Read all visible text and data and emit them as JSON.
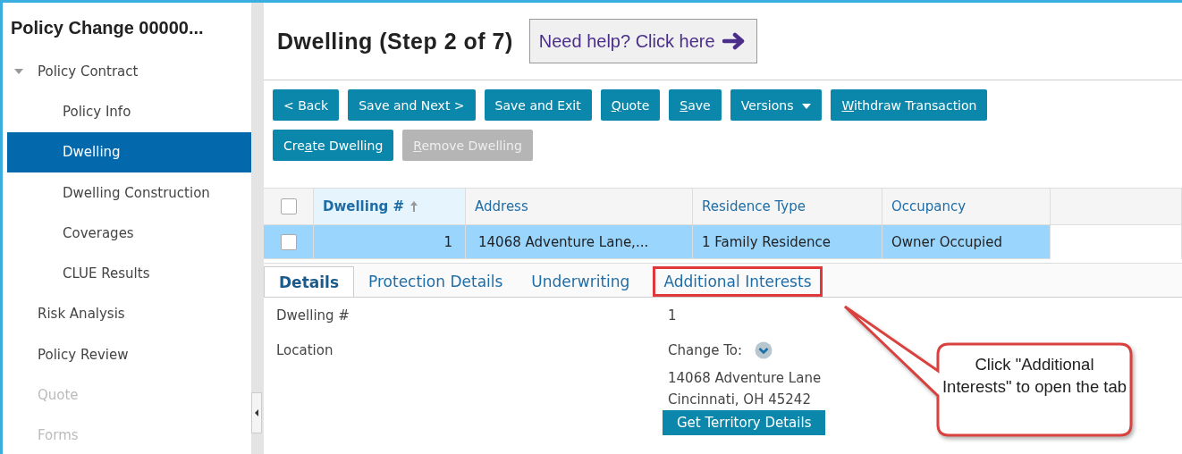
{
  "sidebar": {
    "title": "Policy Change 00000...",
    "items": [
      {
        "label": "Policy Contract",
        "selected": false,
        "disabled": false,
        "expanded": true,
        "children": [
          {
            "label": "Policy Info",
            "selected": false,
            "disabled": false
          },
          {
            "label": "Dwelling",
            "selected": true,
            "disabled": false
          },
          {
            "label": "Dwelling Construction",
            "selected": false,
            "disabled": false
          },
          {
            "label": "Coverages",
            "selected": false,
            "disabled": false
          },
          {
            "label": "CLUE Results",
            "selected": false,
            "disabled": false
          }
        ]
      },
      {
        "label": "Risk Analysis",
        "selected": false,
        "disabled": false
      },
      {
        "label": "Policy Review",
        "selected": false,
        "disabled": false
      },
      {
        "label": "Quote",
        "selected": false,
        "disabled": true
      },
      {
        "label": "Forms",
        "selected": false,
        "disabled": true
      }
    ]
  },
  "page": {
    "title": "Dwelling (Step 2 of 7)",
    "help_button": "Need help? Click here"
  },
  "toolbar": [
    {
      "before": "< Back",
      "kind": "plain",
      "disabled": false
    },
    {
      "before": "Save and Next >",
      "kind": "plain",
      "disabled": false
    },
    {
      "before": "Save and Exit",
      "kind": "plain",
      "disabled": false
    },
    {
      "key": "Q",
      "after": "uote",
      "kind": "plain",
      "disabled": false
    },
    {
      "key": "S",
      "after": "ave",
      "kind": "plain",
      "disabled": false
    },
    {
      "before": "Versions",
      "kind": "dropdown",
      "disabled": false
    },
    {
      "key": "W",
      "after": "ithdraw Transaction",
      "kind": "plain",
      "disabled": false
    }
  ],
  "toolbar_2": [
    {
      "before": "Cre",
      "key": "a",
      "after": "te Dwelling",
      "disabled": false
    },
    {
      "key": "R",
      "after": "emove Dwelling",
      "disabled": true
    }
  ],
  "table": {
    "all_checked": false,
    "columns": [
      {
        "label": "Dwelling #",
        "sorted": true
      },
      {
        "label": "Address",
        "sorted": false
      },
      {
        "label": "Residence Type",
        "sorted": false
      },
      {
        "label": "Occupancy",
        "sorted": false
      }
    ],
    "rows": [
      {
        "selected": true,
        "checked": false,
        "cells": [
          "1",
          "14068 Adventure Lane,...",
          "1 Family Residence",
          "Owner Occupied"
        ]
      }
    ]
  },
  "tabs": [
    {
      "label": "Details",
      "selected": true,
      "highlighted": false
    },
    {
      "label": "Protection Details",
      "selected": false,
      "highlighted": false
    },
    {
      "label": "Underwriting",
      "selected": false,
      "highlighted": false
    },
    {
      "label": "Additional Interests",
      "selected": false,
      "highlighted": true
    }
  ],
  "details": {
    "fields": [
      {
        "label": "Dwelling #",
        "value": "1"
      },
      {
        "label": "Location",
        "value": "Change To:"
      }
    ],
    "address_lines": [
      "14068 Adventure Lane",
      "Cincinnati, OH 45242"
    ],
    "territory_button": "Get Territory Details"
  },
  "callout": {
    "text": "Click \"Additional Interests\" to open the tab"
  }
}
